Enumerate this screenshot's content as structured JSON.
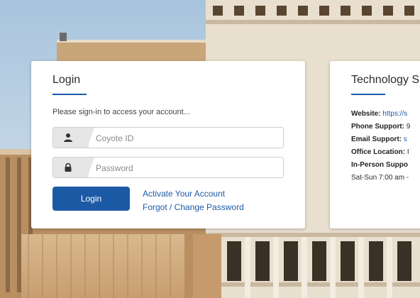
{
  "login": {
    "title": "Login",
    "prompt": "Please sign-in to access your account...",
    "username_placeholder": "Coyote ID",
    "password_placeholder": "Password",
    "login_button": "Login",
    "activate_link": "Activate Your Account",
    "forgot_link": "Forgot / Change Password"
  },
  "tech": {
    "title": "Technology S",
    "website_label": "Website:",
    "website_value": "https://s",
    "phone_label": "Phone Support:",
    "phone_value": "9",
    "email_label": "Email Support:",
    "email_value": "s",
    "office_label": "Office Location:",
    "office_value": "I",
    "inperson_label": "In-Person Suppo",
    "hours": "Sat-Sun 7:00 am -"
  },
  "colors": {
    "accent": "#1d5aa6",
    "card_bg": "#ffffff",
    "icon_box": "#e6e6e6"
  },
  "icons": {
    "username": "user-icon",
    "password": "lock-icon"
  }
}
